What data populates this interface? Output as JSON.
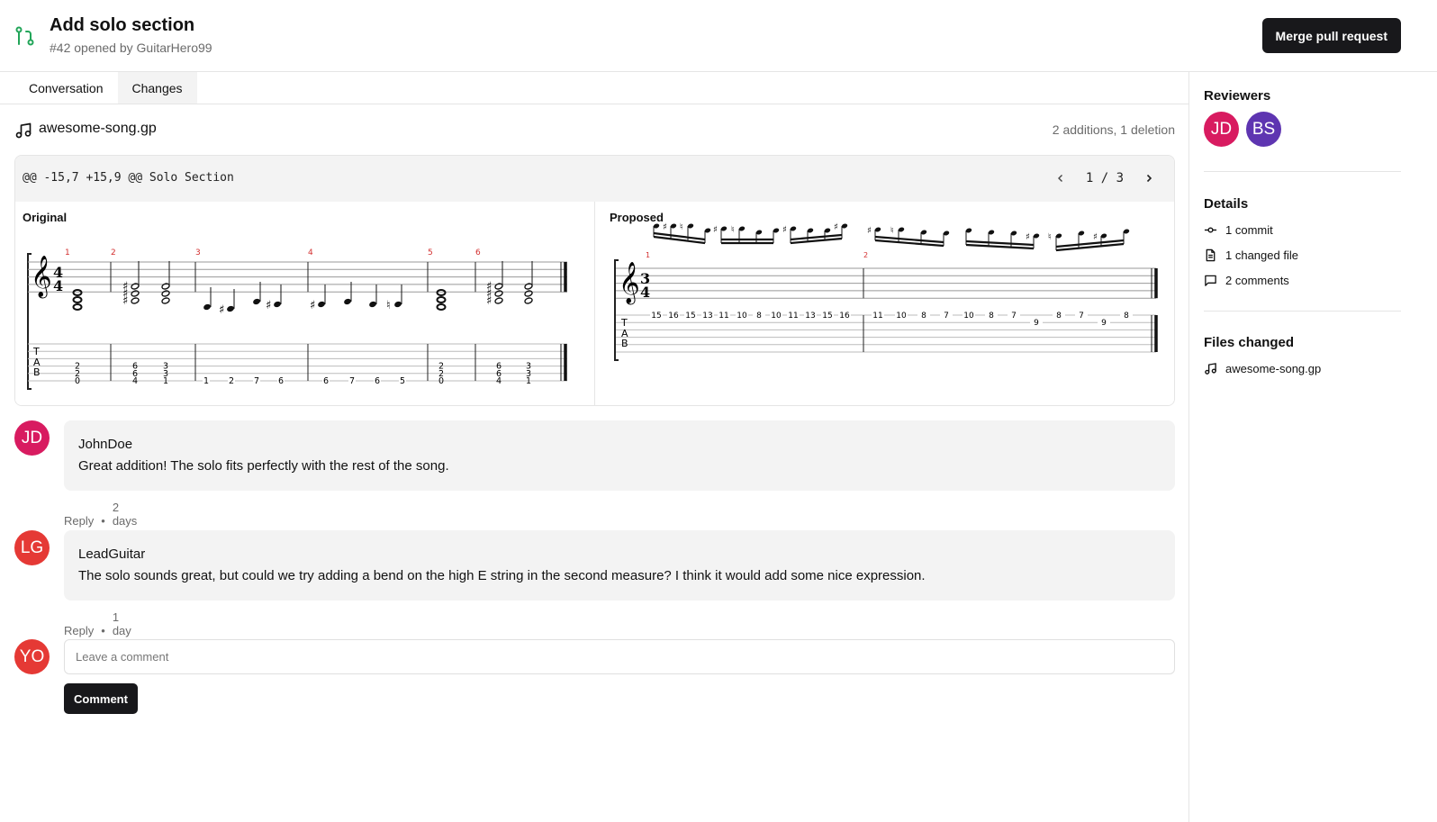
{
  "header": {
    "title": "Add solo section",
    "subtitle": "#42 opened by GuitarHero99",
    "merge_button": "Merge pull request",
    "icon": "pull-request-icon",
    "icon_color": "#22a559"
  },
  "tabs": [
    {
      "label": "Conversation",
      "active": false
    },
    {
      "label": "Changes",
      "active": true
    }
  ],
  "file": {
    "icon": "music-note-icon",
    "name": "awesome-song.gp",
    "stats": "2 additions, 1 deletion"
  },
  "diff": {
    "hunk_header": "@@ -15,7 +15,9 @@ Solo Section",
    "pager": {
      "current": "1",
      "separator": "/",
      "total": "3",
      "prev_icon": "chevron-left-icon",
      "next_icon": "chevron-right-icon"
    },
    "original": {
      "label": "Original",
      "time_signature": [
        "4",
        "4"
      ],
      "measure_numbers": [
        "1",
        "2",
        "3",
        "4",
        "5",
        "6"
      ],
      "tab_measures": [
        [
          [
            "2",
            "2",
            "0"
          ]
        ],
        [
          [
            "6",
            "6",
            "4"
          ],
          [
            "3",
            "3",
            "1"
          ]
        ],
        [
          [
            "1"
          ],
          [
            "2"
          ],
          [
            "7"
          ],
          [
            "6"
          ]
        ],
        [
          [
            "6"
          ],
          [
            "7"
          ],
          [
            "6"
          ],
          [
            "5"
          ]
        ],
        [
          [
            "2",
            "2",
            "0"
          ]
        ],
        [
          [
            "6",
            "6",
            "4"
          ],
          [
            "3",
            "3",
            "1"
          ]
        ]
      ]
    },
    "proposed": {
      "label": "Proposed",
      "time_signature": [
        "3",
        "4"
      ],
      "measure_numbers": [
        "1",
        "2"
      ],
      "tab_measures": [
        [
          "15",
          "16",
          "15",
          "13",
          "11",
          "10",
          "8",
          "10",
          "11",
          "13",
          "15",
          "16"
        ],
        [
          "11",
          "10",
          "8",
          "7",
          "10",
          "8",
          "7",
          "9",
          "8",
          "7",
          "9",
          "8"
        ]
      ]
    },
    "measure_number_color": "#d32f2f"
  },
  "comments": [
    {
      "initials": "JD",
      "avatar_color": "#d81b60",
      "author": "JohnDoe",
      "text": "Great addition! The solo fits perfectly with the rest of the song.",
      "reply": "Reply",
      "dot": "•",
      "time": "2 days ago"
    },
    {
      "initials": "LG",
      "avatar_color": "#e53935",
      "author": "LeadGuitar",
      "text": "The solo sounds great, but could we try adding a bend on the high E string in the second measure? I think it would add some nice expression.",
      "reply": "Reply",
      "dot": "•",
      "time": "1 day ago"
    }
  ],
  "new_comment": {
    "initials": "YO",
    "avatar_color": "#e53935",
    "placeholder": "Leave a comment",
    "value": "",
    "button": "Comment"
  },
  "sidebar": {
    "reviewers_title": "Reviewers",
    "reviewers": [
      {
        "initials": "JD",
        "color": "#d81b60"
      },
      {
        "initials": "BS",
        "color": "#5e35b1"
      }
    ],
    "details_title": "Details",
    "details": [
      {
        "icon": "commit-icon",
        "label": "1 commit"
      },
      {
        "icon": "file-icon",
        "label": "1 changed file"
      },
      {
        "icon": "comment-icon",
        "label": "2 comments"
      }
    ],
    "files_title": "Files changed",
    "files": [
      {
        "icon": "music-note-icon",
        "label": "awesome-song.gp"
      }
    ]
  }
}
